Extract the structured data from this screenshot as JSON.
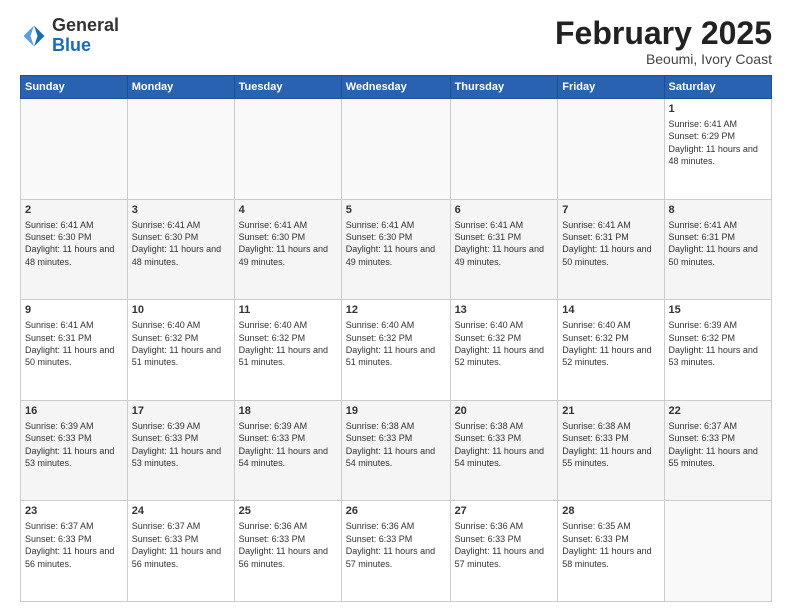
{
  "header": {
    "logo_general": "General",
    "logo_blue": "Blue",
    "month_title": "February 2025",
    "location": "Beoumi, Ivory Coast"
  },
  "weekdays": [
    "Sunday",
    "Monday",
    "Tuesday",
    "Wednesday",
    "Thursday",
    "Friday",
    "Saturday"
  ],
  "weeks": [
    [
      {
        "day": "",
        "info": ""
      },
      {
        "day": "",
        "info": ""
      },
      {
        "day": "",
        "info": ""
      },
      {
        "day": "",
        "info": ""
      },
      {
        "day": "",
        "info": ""
      },
      {
        "day": "",
        "info": ""
      },
      {
        "day": "1",
        "info": "Sunrise: 6:41 AM\nSunset: 6:29 PM\nDaylight: 11 hours and 48 minutes."
      }
    ],
    [
      {
        "day": "2",
        "info": "Sunrise: 6:41 AM\nSunset: 6:30 PM\nDaylight: 11 hours and 48 minutes."
      },
      {
        "day": "3",
        "info": "Sunrise: 6:41 AM\nSunset: 6:30 PM\nDaylight: 11 hours and 48 minutes."
      },
      {
        "day": "4",
        "info": "Sunrise: 6:41 AM\nSunset: 6:30 PM\nDaylight: 11 hours and 49 minutes."
      },
      {
        "day": "5",
        "info": "Sunrise: 6:41 AM\nSunset: 6:30 PM\nDaylight: 11 hours and 49 minutes."
      },
      {
        "day": "6",
        "info": "Sunrise: 6:41 AM\nSunset: 6:31 PM\nDaylight: 11 hours and 49 minutes."
      },
      {
        "day": "7",
        "info": "Sunrise: 6:41 AM\nSunset: 6:31 PM\nDaylight: 11 hours and 50 minutes."
      },
      {
        "day": "8",
        "info": "Sunrise: 6:41 AM\nSunset: 6:31 PM\nDaylight: 11 hours and 50 minutes."
      }
    ],
    [
      {
        "day": "9",
        "info": "Sunrise: 6:41 AM\nSunset: 6:31 PM\nDaylight: 11 hours and 50 minutes."
      },
      {
        "day": "10",
        "info": "Sunrise: 6:40 AM\nSunset: 6:32 PM\nDaylight: 11 hours and 51 minutes."
      },
      {
        "day": "11",
        "info": "Sunrise: 6:40 AM\nSunset: 6:32 PM\nDaylight: 11 hours and 51 minutes."
      },
      {
        "day": "12",
        "info": "Sunrise: 6:40 AM\nSunset: 6:32 PM\nDaylight: 11 hours and 51 minutes."
      },
      {
        "day": "13",
        "info": "Sunrise: 6:40 AM\nSunset: 6:32 PM\nDaylight: 11 hours and 52 minutes."
      },
      {
        "day": "14",
        "info": "Sunrise: 6:40 AM\nSunset: 6:32 PM\nDaylight: 11 hours and 52 minutes."
      },
      {
        "day": "15",
        "info": "Sunrise: 6:39 AM\nSunset: 6:32 PM\nDaylight: 11 hours and 53 minutes."
      }
    ],
    [
      {
        "day": "16",
        "info": "Sunrise: 6:39 AM\nSunset: 6:33 PM\nDaylight: 11 hours and 53 minutes."
      },
      {
        "day": "17",
        "info": "Sunrise: 6:39 AM\nSunset: 6:33 PM\nDaylight: 11 hours and 53 minutes."
      },
      {
        "day": "18",
        "info": "Sunrise: 6:39 AM\nSunset: 6:33 PM\nDaylight: 11 hours and 54 minutes."
      },
      {
        "day": "19",
        "info": "Sunrise: 6:38 AM\nSunset: 6:33 PM\nDaylight: 11 hours and 54 minutes."
      },
      {
        "day": "20",
        "info": "Sunrise: 6:38 AM\nSunset: 6:33 PM\nDaylight: 11 hours and 54 minutes."
      },
      {
        "day": "21",
        "info": "Sunrise: 6:38 AM\nSunset: 6:33 PM\nDaylight: 11 hours and 55 minutes."
      },
      {
        "day": "22",
        "info": "Sunrise: 6:37 AM\nSunset: 6:33 PM\nDaylight: 11 hours and 55 minutes."
      }
    ],
    [
      {
        "day": "23",
        "info": "Sunrise: 6:37 AM\nSunset: 6:33 PM\nDaylight: 11 hours and 56 minutes."
      },
      {
        "day": "24",
        "info": "Sunrise: 6:37 AM\nSunset: 6:33 PM\nDaylight: 11 hours and 56 minutes."
      },
      {
        "day": "25",
        "info": "Sunrise: 6:36 AM\nSunset: 6:33 PM\nDaylight: 11 hours and 56 minutes."
      },
      {
        "day": "26",
        "info": "Sunrise: 6:36 AM\nSunset: 6:33 PM\nDaylight: 11 hours and 57 minutes."
      },
      {
        "day": "27",
        "info": "Sunrise: 6:36 AM\nSunset: 6:33 PM\nDaylight: 11 hours and 57 minutes."
      },
      {
        "day": "28",
        "info": "Sunrise: 6:35 AM\nSunset: 6:33 PM\nDaylight: 11 hours and 58 minutes."
      },
      {
        "day": "",
        "info": ""
      }
    ]
  ]
}
